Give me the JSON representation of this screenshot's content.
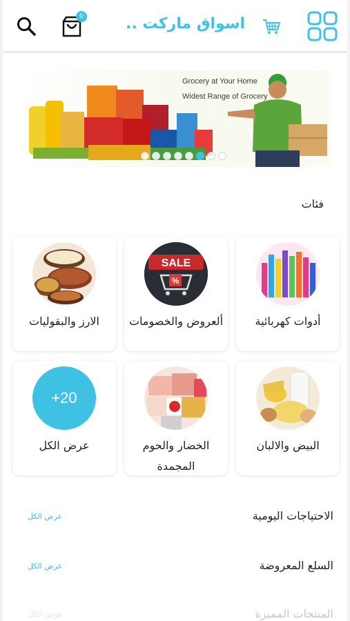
{
  "header": {
    "app_title": "اسواق ماركت ...",
    "cart_count": "0",
    "icons": {
      "search": "search-icon",
      "cart": "shopping-bag-icon",
      "title_cart": "cart-icon",
      "menu": "grid-menu-icon"
    }
  },
  "banner": {
    "line1": "Grocery at Your Home",
    "line2": "Widest Range of Grocery",
    "active_slide": 6,
    "slides": 8
  },
  "categories_section": {
    "title": "فئات",
    "items": [
      {
        "label": "أدوات كهربائية",
        "image": "stationery-image"
      },
      {
        "label": "ألعروض والخصومات",
        "image": "sale-image",
        "sale_text": "SALE",
        "percent_text": "%"
      },
      {
        "label": "الارز والبقوليات",
        "image": "rice-legumes-image"
      },
      {
        "label": "البيض والالبان",
        "image": "eggs-dairy-image"
      },
      {
        "label": "الخضار والحوم المجمدة",
        "image": "frozen-food-image"
      },
      {
        "label": "عرض الكل",
        "badge": "+20"
      }
    ]
  },
  "lists": [
    {
      "title": "الاحتياجات اليومية",
      "link": "عرض الكل"
    },
    {
      "title": "السلع المعروضة",
      "link": "عرض الكل"
    },
    {
      "title": "المنتجات المميزة",
      "link": "عرض الكل"
    }
  ],
  "colors": {
    "accent": "#3ec1e2",
    "text": "#222222",
    "background": "#ffffff"
  }
}
